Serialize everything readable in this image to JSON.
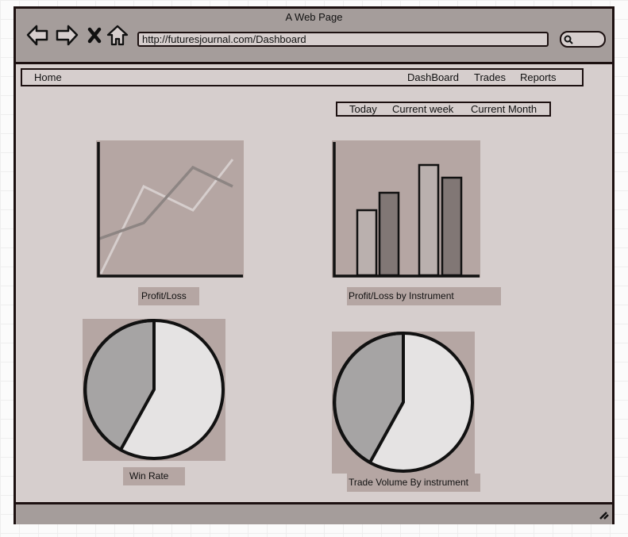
{
  "browser": {
    "title": "A Web Page",
    "url": "http://futuresjournal.com/Dashboard",
    "icons": [
      "back-arrow-icon",
      "forward-arrow-icon",
      "stop-icon",
      "home-icon",
      "search-icon",
      "resize-grip-icon"
    ]
  },
  "nav": {
    "home": "Home",
    "items": [
      "DashBoard",
      "Trades",
      "Reports"
    ]
  },
  "tabs": [
    "Today",
    "Current week",
    "Current Month"
  ],
  "charts": {
    "profit_loss": {
      "type": "line",
      "label": "Profit/Loss"
    },
    "by_instrument": {
      "type": "bar",
      "label": "Profit/Loss by Instrument"
    },
    "win_rate": {
      "type": "pie",
      "label": "Win Rate"
    },
    "trade_volume": {
      "type": "pie",
      "label": "Trade Volume By instrument"
    }
  },
  "colors": {
    "frame": "#a59d9b",
    "content": "#d6cecd",
    "chart_bg": "#b5a6a3",
    "outline": "#1c1010"
  }
}
